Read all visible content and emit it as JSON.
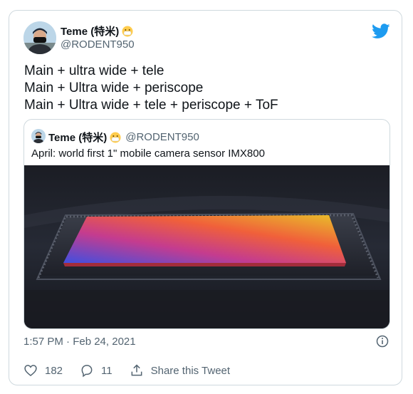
{
  "author": {
    "name": "Teme (特米)",
    "handle": "@RODENT950"
  },
  "tweet": {
    "lines": [
      "Main + ultra wide + tele",
      "Main + Ultra wide + periscope",
      "Main + Ultra wide + tele + periscope + ToF"
    ]
  },
  "quoted": {
    "name": "Teme (特米)",
    "handle": "@RODENT950",
    "text": "April: world first 1\" mobile camera sensor IMX800"
  },
  "timestamp": "1:57 PM · Feb 24, 2021",
  "actions": {
    "likes": "182",
    "replies": "11",
    "share_label": "Share this Tweet"
  },
  "colors": {
    "twitter_blue": "#1d9bf0",
    "secondary_text": "#536471"
  },
  "icons": [
    "twitter-bird-icon",
    "mask-emoji-icon",
    "info-icon",
    "heart-icon",
    "reply-icon",
    "share-icon"
  ]
}
